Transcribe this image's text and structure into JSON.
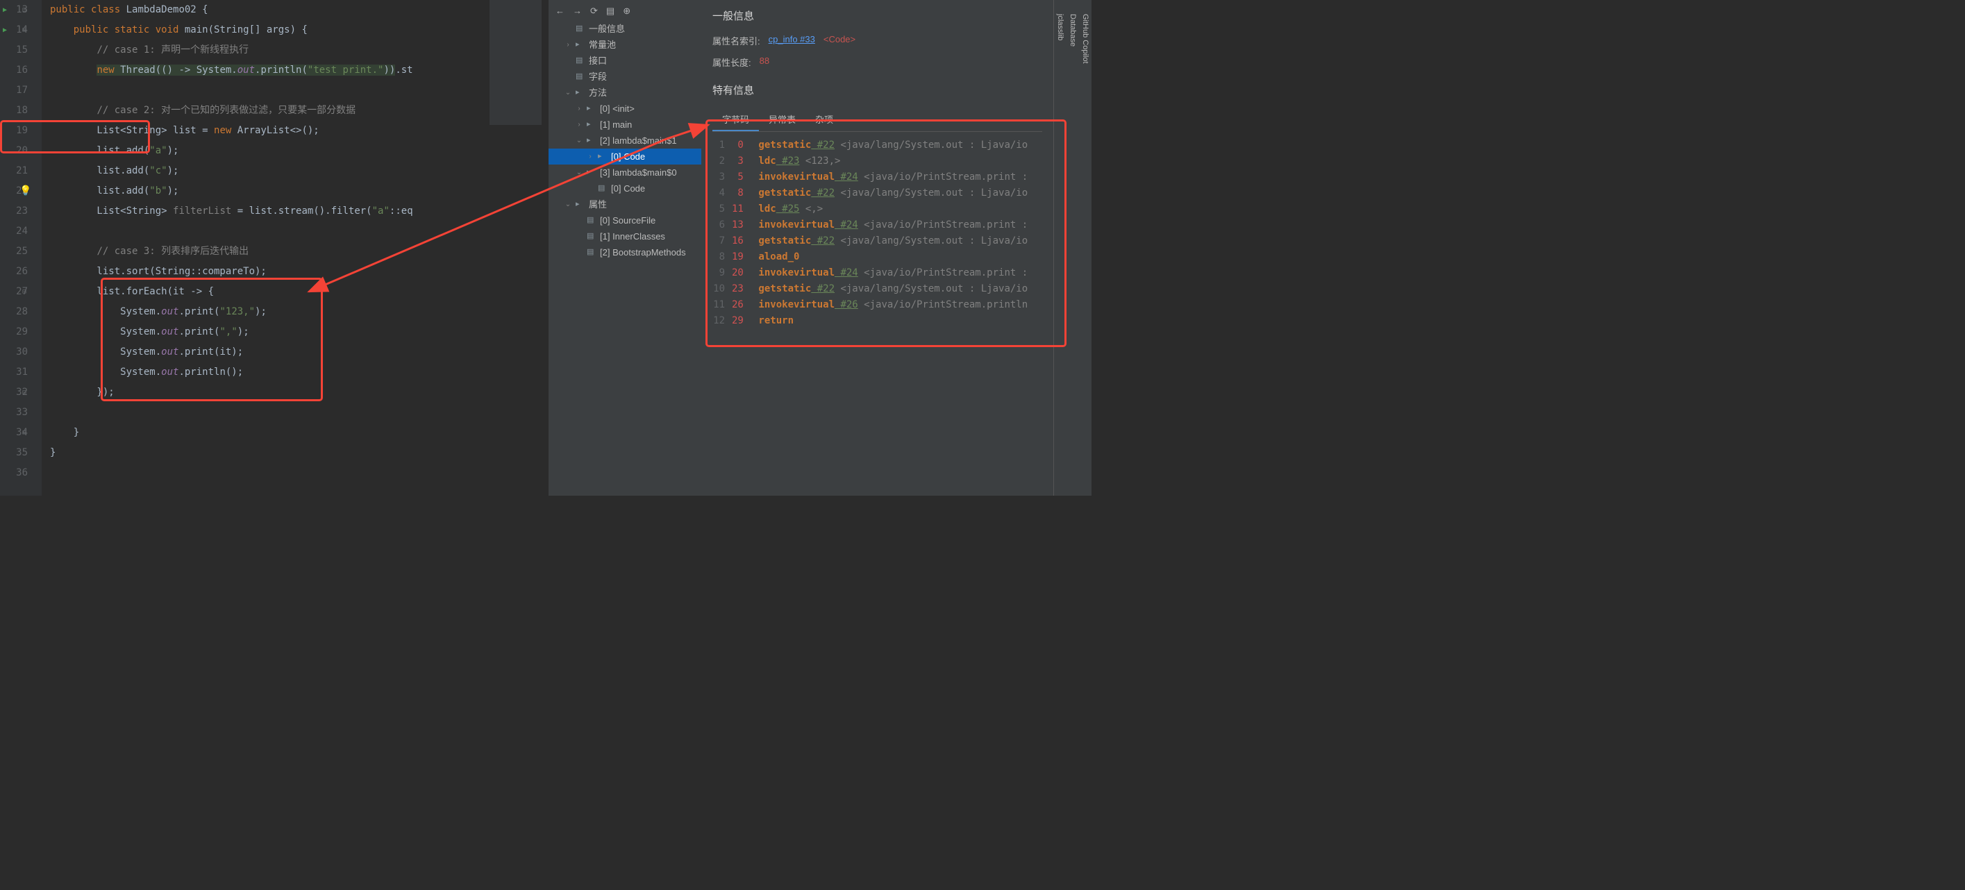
{
  "editor": {
    "lines": [
      {
        "num": 13,
        "run": true,
        "fold": "-",
        "tokens": [
          {
            "t": "public ",
            "c": "kw"
          },
          {
            "t": "class ",
            "c": "kw"
          },
          {
            "t": "LambdaDemo02 {",
            "c": ""
          }
        ]
      },
      {
        "num": 14,
        "run": true,
        "fold": "-",
        "tokens": [
          {
            "t": "    ",
            "c": ""
          },
          {
            "t": "public static void ",
            "c": "kw"
          },
          {
            "t": "main(String[] args) {",
            "c": ""
          }
        ]
      },
      {
        "num": 15,
        "tokens": [
          {
            "t": "        ",
            "c": ""
          },
          {
            "t": "// case 1: 声明一个新线程执行",
            "c": "com"
          }
        ]
      },
      {
        "num": 16,
        "tokens": [
          {
            "t": "        ",
            "c": ""
          },
          {
            "t": "new ",
            "c": "kw hl"
          },
          {
            "t": "Thread(() -> System.",
            "c": "hl"
          },
          {
            "t": "out",
            "c": "field hl"
          },
          {
            "t": ".println(",
            "c": "hl"
          },
          {
            "t": "\"test print.\"",
            "c": "str hl"
          },
          {
            "t": "))",
            "c": "hl"
          },
          {
            "t": ".st",
            "c": ""
          }
        ]
      },
      {
        "num": 17,
        "tokens": [
          {
            "t": "",
            "c": ""
          }
        ]
      },
      {
        "num": 18,
        "tokens": [
          {
            "t": "        ",
            "c": ""
          },
          {
            "t": "// case 2: 对一个已知的列表做过滤，只要某一部分数据",
            "c": "com"
          }
        ]
      },
      {
        "num": 19,
        "tokens": [
          {
            "t": "        List<String> list = ",
            "c": ""
          },
          {
            "t": "new ",
            "c": "kw"
          },
          {
            "t": "ArrayList<>();",
            "c": ""
          }
        ]
      },
      {
        "num": 20,
        "tokens": [
          {
            "t": "        list.add(",
            "c": ""
          },
          {
            "t": "\"a\"",
            "c": "str"
          },
          {
            "t": ");",
            "c": ""
          }
        ]
      },
      {
        "num": 21,
        "tokens": [
          {
            "t": "        list.add(",
            "c": ""
          },
          {
            "t": "\"c\"",
            "c": "str"
          },
          {
            "t": ");",
            "c": ""
          }
        ]
      },
      {
        "num": 22,
        "bulb": true,
        "tokens": [
          {
            "t": "        list.add(",
            "c": ""
          },
          {
            "t": "\"b\"",
            "c": "str"
          },
          {
            "t": ");",
            "c": ""
          }
        ]
      },
      {
        "num": 23,
        "tokens": [
          {
            "t": "        List<String> ",
            "c": ""
          },
          {
            "t": "filterList",
            "c": "com"
          },
          {
            "t": " = list.stream().filter(",
            "c": ""
          },
          {
            "t": "\"a\"",
            "c": "str"
          },
          {
            "t": "::eq",
            "c": ""
          }
        ]
      },
      {
        "num": 24,
        "tokens": [
          {
            "t": "",
            "c": ""
          }
        ]
      },
      {
        "num": 25,
        "tokens": [
          {
            "t": "        ",
            "c": ""
          },
          {
            "t": "// case 3: 列表排序后迭代输出",
            "c": "com"
          }
        ]
      },
      {
        "num": 26,
        "tokens": [
          {
            "t": "        list.sort(String::compareTo);",
            "c": ""
          }
        ]
      },
      {
        "num": 27,
        "fold": "-",
        "tokens": [
          {
            "t": "        list.forEach(it -> {",
            "c": ""
          }
        ]
      },
      {
        "num": 28,
        "tokens": [
          {
            "t": "            System.",
            "c": ""
          },
          {
            "t": "out",
            "c": "field"
          },
          {
            "t": ".print(",
            "c": ""
          },
          {
            "t": "\"123,\"",
            "c": "str"
          },
          {
            "t": ");",
            "c": ""
          }
        ]
      },
      {
        "num": 29,
        "tokens": [
          {
            "t": "            System.",
            "c": ""
          },
          {
            "t": "out",
            "c": "field"
          },
          {
            "t": ".print(",
            "c": ""
          },
          {
            "t": "\",\"",
            "c": "str"
          },
          {
            "t": ");",
            "c": ""
          }
        ]
      },
      {
        "num": 30,
        "tokens": [
          {
            "t": "            System.",
            "c": ""
          },
          {
            "t": "out",
            "c": "field"
          },
          {
            "t": ".print(it);",
            "c": ""
          }
        ]
      },
      {
        "num": 31,
        "tokens": [
          {
            "t": "            System.",
            "c": ""
          },
          {
            "t": "out",
            "c": "field"
          },
          {
            "t": ".println();",
            "c": ""
          }
        ]
      },
      {
        "num": 32,
        "fold": "-",
        "tokens": [
          {
            "t": "        });",
            "c": ""
          }
        ]
      },
      {
        "num": 33,
        "tokens": [
          {
            "t": "",
            "c": ""
          }
        ]
      },
      {
        "num": 34,
        "fold": "-",
        "tokens": [
          {
            "t": "    }",
            "c": ""
          }
        ]
      },
      {
        "num": 35,
        "tokens": [
          {
            "t": "}",
            "c": ""
          }
        ]
      },
      {
        "num": 36,
        "tokens": [
          {
            "t": "",
            "c": ""
          }
        ]
      }
    ]
  },
  "tree": {
    "items": [
      {
        "indent": 1,
        "chev": "",
        "icon": "file",
        "label": "一般信息"
      },
      {
        "indent": 1,
        "chev": "›",
        "icon": "folder",
        "label": "常量池"
      },
      {
        "indent": 1,
        "chev": "",
        "icon": "file",
        "label": "接口"
      },
      {
        "indent": 1,
        "chev": "",
        "icon": "file",
        "label": "字段"
      },
      {
        "indent": 1,
        "chev": "⌄",
        "icon": "folder",
        "label": "方法"
      },
      {
        "indent": 2,
        "chev": "›",
        "icon": "folder",
        "label": "[0] <init>"
      },
      {
        "indent": 2,
        "chev": "›",
        "icon": "folder",
        "label": "[1] main"
      },
      {
        "indent": 2,
        "chev": "⌄",
        "icon": "folder",
        "label": "[2] lambda$main$1"
      },
      {
        "indent": 3,
        "chev": "›",
        "icon": "folder",
        "label": "[0] Code",
        "selected": true
      },
      {
        "indent": 2,
        "chev": "⌄",
        "icon": "folder",
        "label": "[3] lambda$main$0"
      },
      {
        "indent": 3,
        "chev": "",
        "icon": "file",
        "label": "[0] Code"
      },
      {
        "indent": 1,
        "chev": "⌄",
        "icon": "folder",
        "label": "属性"
      },
      {
        "indent": 2,
        "chev": "",
        "icon": "file",
        "label": "[0] SourceFile"
      },
      {
        "indent": 2,
        "chev": "",
        "icon": "file",
        "label": "[1] InnerClasses"
      },
      {
        "indent": 2,
        "chev": "",
        "icon": "file",
        "label": "[2] BootstrapMethods"
      }
    ]
  },
  "detail": {
    "title": "一般信息",
    "attr_index_label": "属性名索引:",
    "attr_index_link": "cp_info #33",
    "attr_index_tag": "<Code>",
    "attr_len_label": "属性长度:",
    "attr_len_val": "88",
    "special_title": "特有信息",
    "tabs": [
      "字节码",
      "异常表",
      "杂项"
    ],
    "bytecode": [
      {
        "n": 1,
        "off": "0",
        "op": "getstatic",
        "ref": "#22",
        "info": "<java/lang/System.out : Ljava/io"
      },
      {
        "n": 2,
        "off": "3",
        "op": "ldc",
        "ref": "#23",
        "info": "<123,>"
      },
      {
        "n": 3,
        "off": "5",
        "op": "invokevirtual",
        "ref": "#24",
        "info": "<java/io/PrintStream.print :"
      },
      {
        "n": 4,
        "off": "8",
        "op": "getstatic",
        "ref": "#22",
        "info": "<java/lang/System.out : Ljava/io"
      },
      {
        "n": 5,
        "off": "11",
        "op": "ldc",
        "ref": "#25",
        "info": "<,>"
      },
      {
        "n": 6,
        "off": "13",
        "op": "invokevirtual",
        "ref": "#24",
        "info": "<java/io/PrintStream.print :"
      },
      {
        "n": 7,
        "off": "16",
        "op": "getstatic",
        "ref": "#22",
        "info": "<java/lang/System.out : Ljava/io"
      },
      {
        "n": 8,
        "off": "19",
        "op": "aload_0",
        "ref": "",
        "info": ""
      },
      {
        "n": 9,
        "off": "20",
        "op": "invokevirtual",
        "ref": "#24",
        "info": "<java/io/PrintStream.print :"
      },
      {
        "n": 10,
        "off": "23",
        "op": "getstatic",
        "ref": "#22",
        "info": "<java/lang/System.out : Ljava/io"
      },
      {
        "n": 11,
        "off": "26",
        "op": "invokevirtual",
        "ref": "#26",
        "info": "<java/io/PrintStream.println"
      },
      {
        "n": 12,
        "off": "29",
        "op": "return",
        "ref": "",
        "info": ""
      }
    ]
  },
  "rightbar": {
    "tabs": [
      "GitHub Copilot",
      "Database",
      "jclasslib"
    ]
  }
}
